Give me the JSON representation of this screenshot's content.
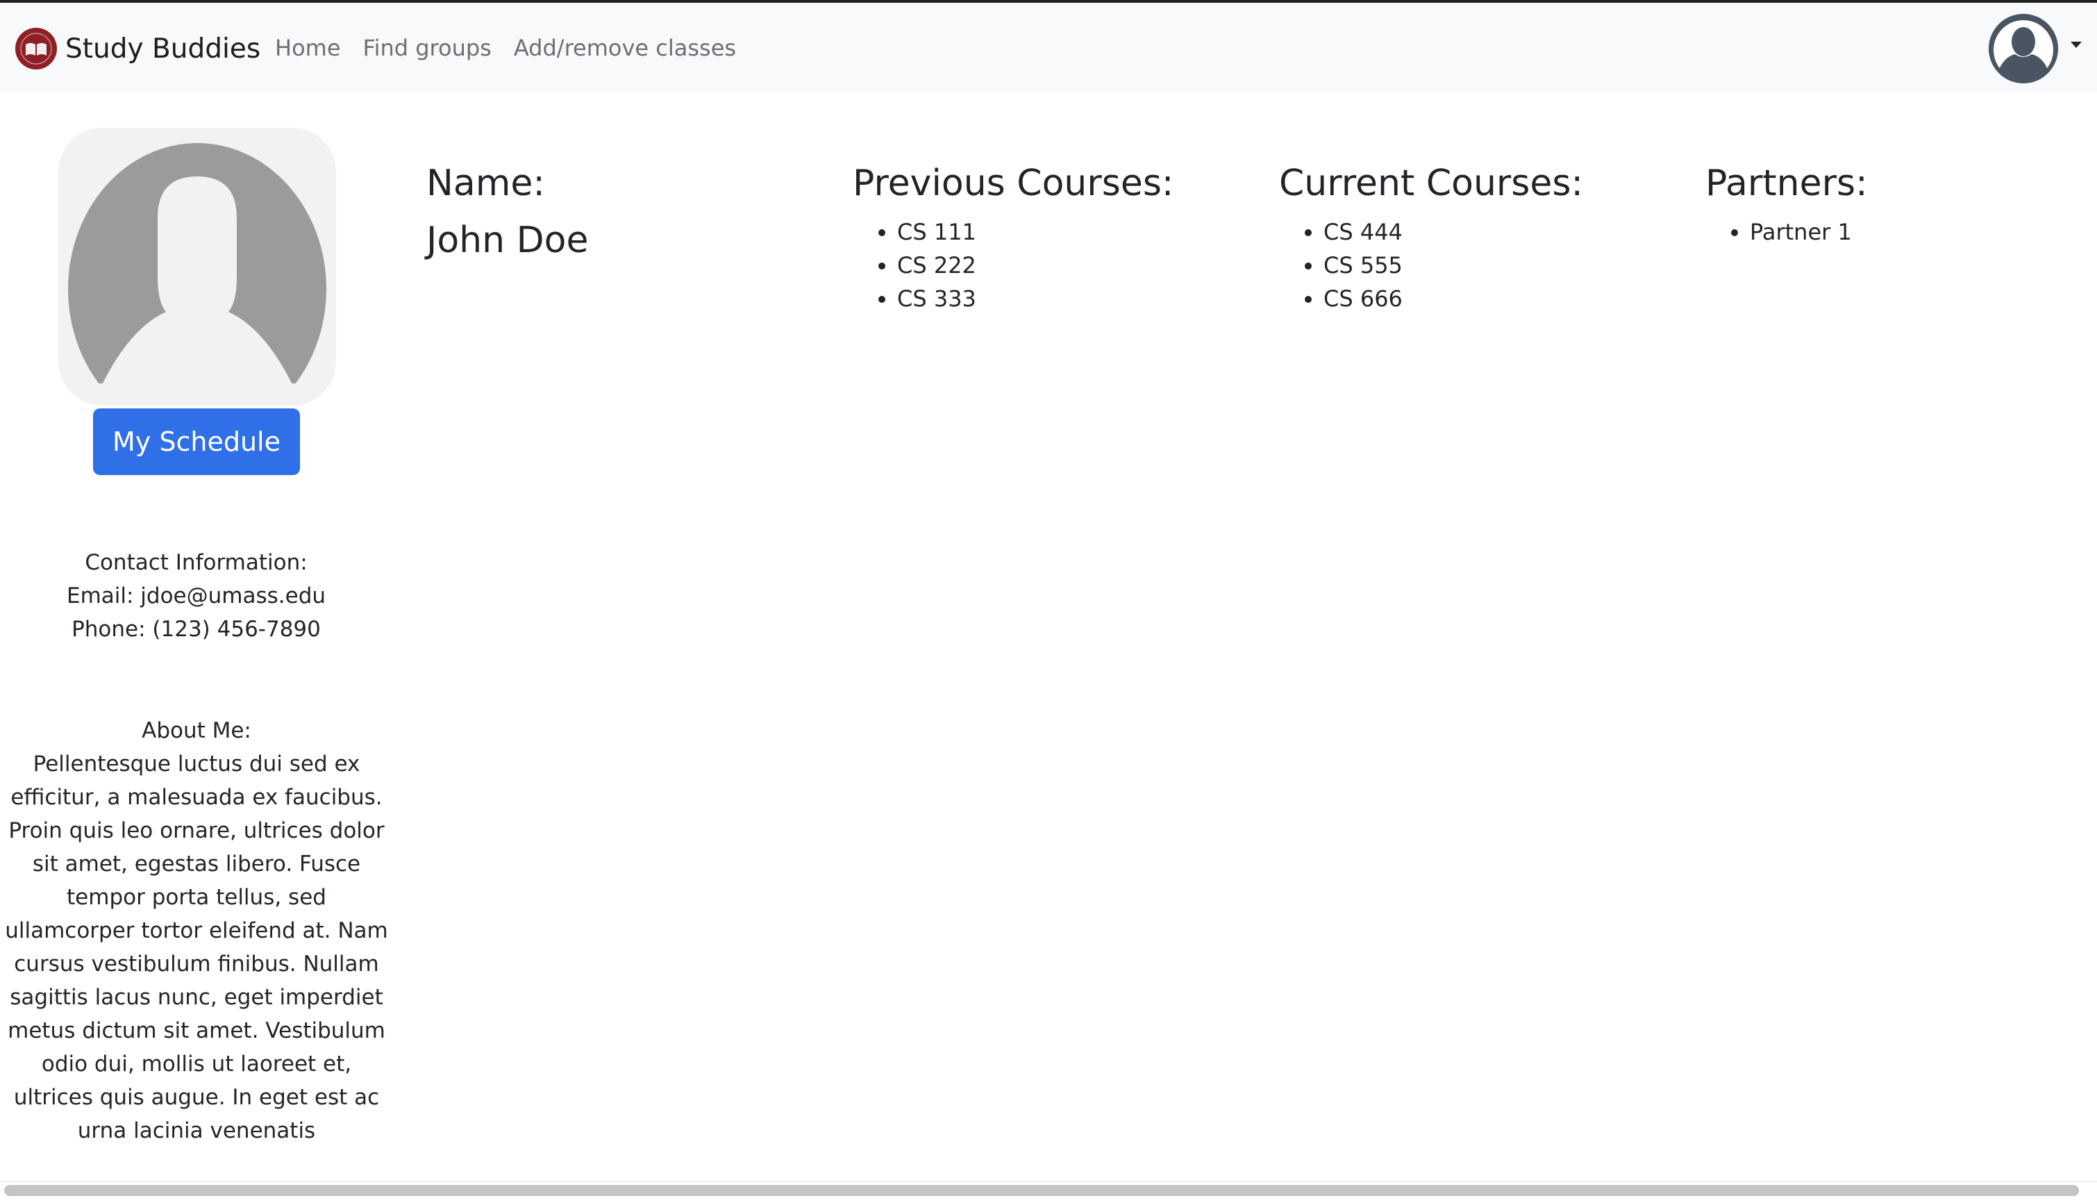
{
  "nav": {
    "brand": "Study Buddies",
    "links": [
      "Home",
      "Find groups",
      "Add/remove classes"
    ]
  },
  "colors": {
    "accent": "#2f6fe8",
    "logo": "#8e1f26",
    "navbar_bg": "#f8f9fa"
  },
  "icons": {
    "brand_logo": "book-logo-icon",
    "nav_avatar": "user-avatar-icon",
    "dropdown": "caret-down-icon",
    "profile_picture": "default-profile-icon"
  },
  "profile": {
    "schedule_button": "My Schedule",
    "contact_heading": "Contact Information:",
    "email": "Email: jdoe@umass.edu",
    "phone": "Phone: (123) 456-7890",
    "about_heading": "About Me:",
    "about_text": "Pellentesque luctus dui sed ex efficitur, a malesuada ex faucibus. Proin quis leo ornare, ultrices dolor sit amet, egestas libero. Fusce tempor porta tellus, sed ullamcorper tortor eleifend at. Nam cursus vestibulum finibus. Nullam sagittis lacus nunc, eget imperdiet metus dictum sit amet. Vestibulum odio dui, mollis ut laoreet et, ultrices quis augue. In eget est ac urna lacinia venenatis"
  },
  "name": {
    "heading": "Name:",
    "value": "John Doe"
  },
  "previous_courses": {
    "heading": "Previous Courses:",
    "items": [
      "CS 111",
      "CS 222",
      "CS 333"
    ]
  },
  "current_courses": {
    "heading": "Current Courses:",
    "items": [
      "CS 444",
      "CS 555",
      "CS 666"
    ]
  },
  "partners": {
    "heading": "Partners:",
    "items": [
      "Partner 1"
    ]
  }
}
